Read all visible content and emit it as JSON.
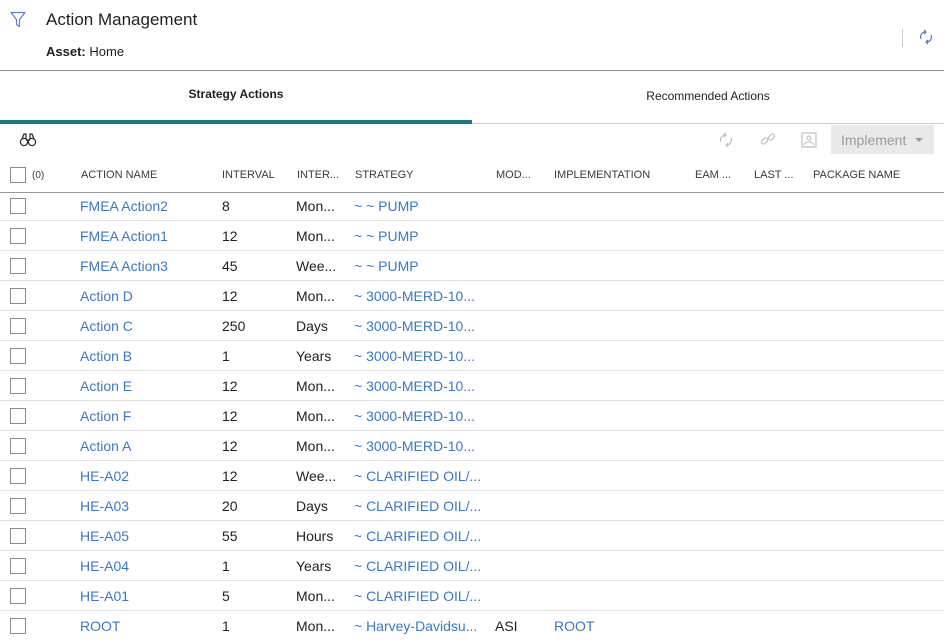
{
  "header": {
    "title": "Action Management",
    "asset_label": "Asset:",
    "asset_value": "Home"
  },
  "tabs": [
    {
      "label": "Strategy Actions",
      "active": true
    },
    {
      "label": "Recommended Actions",
      "active": false
    }
  ],
  "toolbar": {
    "implement_label": "Implement"
  },
  "colors": {
    "accent": "#1a7a8c",
    "link": "#3a78c4",
    "icon": "#5a7fcf"
  },
  "icons": [
    "filter-icon",
    "refresh-icon",
    "binoculars-icon",
    "link-icon",
    "image-icon",
    "chevron-down-icon"
  ],
  "table": {
    "selected_count": "(0)",
    "columns": [
      "ACTION NAME",
      "INTERVAL",
      "INTER...",
      "STRATEGY",
      "MOD...",
      "IMPLEMENTATION",
      "EAM ...",
      "LAST ...",
      "PACKAGE NAME"
    ],
    "rows": [
      {
        "name": "FMEA Action2",
        "interval": "8",
        "unit": "Mon...",
        "strategy": "~ ~ PUMP",
        "mod": "",
        "impl": ""
      },
      {
        "name": "FMEA Action1",
        "interval": "12",
        "unit": "Mon...",
        "strategy": "~ ~ PUMP",
        "mod": "",
        "impl": ""
      },
      {
        "name": "FMEA Action3",
        "interval": "45",
        "unit": "Wee...",
        "strategy": "~ ~ PUMP",
        "mod": "",
        "impl": ""
      },
      {
        "name": "Action D",
        "interval": "12",
        "unit": "Mon...",
        "strategy": "~ 3000-MERD-10...",
        "mod": "",
        "impl": ""
      },
      {
        "name": "Action C",
        "interval": "250",
        "unit": "Days",
        "strategy": "~ 3000-MERD-10...",
        "mod": "",
        "impl": ""
      },
      {
        "name": "Action B",
        "interval": "1",
        "unit": "Years",
        "strategy": "~ 3000-MERD-10...",
        "mod": "",
        "impl": ""
      },
      {
        "name": "Action E",
        "interval": "12",
        "unit": "Mon...",
        "strategy": "~ 3000-MERD-10...",
        "mod": "",
        "impl": ""
      },
      {
        "name": "Action F",
        "interval": "12",
        "unit": "Mon...",
        "strategy": "~ 3000-MERD-10...",
        "mod": "",
        "impl": ""
      },
      {
        "name": "Action A",
        "interval": "12",
        "unit": "Mon...",
        "strategy": "~ 3000-MERD-10...",
        "mod": "",
        "impl": ""
      },
      {
        "name": "HE-A02",
        "interval": "12",
        "unit": "Wee...",
        "strategy": "~ CLARIFIED OIL/...",
        "mod": "",
        "impl": ""
      },
      {
        "name": "HE-A03",
        "interval": "20",
        "unit": "Days",
        "strategy": "~ CLARIFIED OIL/...",
        "mod": "",
        "impl": ""
      },
      {
        "name": "HE-A05",
        "interval": "55",
        "unit": "Hours",
        "strategy": "~ CLARIFIED OIL/...",
        "mod": "",
        "impl": ""
      },
      {
        "name": "HE-A04",
        "interval": "1",
        "unit": "Years",
        "strategy": "~ CLARIFIED OIL/...",
        "mod": "",
        "impl": ""
      },
      {
        "name": "HE-A01",
        "interval": "5",
        "unit": "Mon...",
        "strategy": "~ CLARIFIED OIL/...",
        "mod": "",
        "impl": ""
      },
      {
        "name": "ROOT",
        "interval": "1",
        "unit": "Mon...",
        "strategy": "~ Harvey-Davidsu...",
        "mod": "ASI",
        "impl": "ROOT"
      }
    ]
  }
}
